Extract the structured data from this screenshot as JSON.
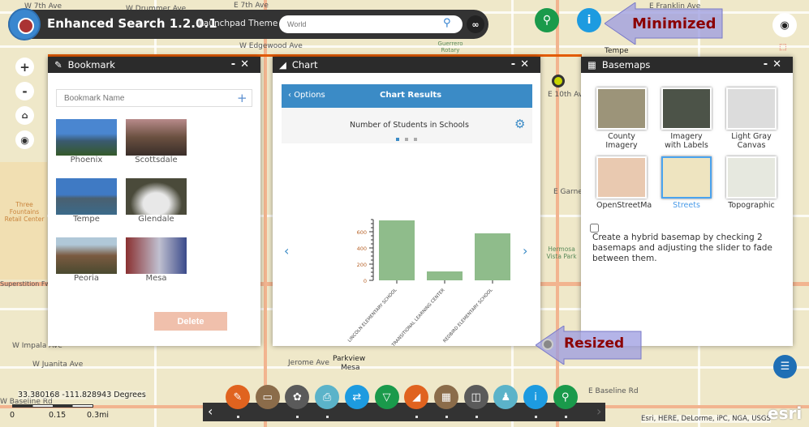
{
  "header": {
    "title": "Enhanced Search 1.2.0.1",
    "theme": "Launchpad Theme",
    "search_placeholder": "World"
  },
  "callouts": {
    "minimized": "Minimized",
    "resized": "Resized"
  },
  "map_labels": [
    "W 7th Ave",
    "W Drummer Ave",
    "W Edgewood Ave",
    "E 7th Ave",
    "E Franklin Ave",
    "Tempe",
    "E 10th Ave",
    "E Garnet",
    "Three Fountains Retail Center",
    "Superstition Fwy",
    "W Impala Ave",
    "W Juanita Ave",
    "Jerome Ave",
    "Parkview",
    "Mesa",
    "E Baseline Rd",
    "W Baseline Rd",
    "Hermosa Vista Park",
    "Guerrero Rotary"
  ],
  "bookmark": {
    "title": "Bookmark",
    "placeholder": "Bookmark Name",
    "items": [
      {
        "name": "Phoenix"
      },
      {
        "name": "Scottsdale"
      },
      {
        "name": "Tempe"
      },
      {
        "name": "Glendale"
      },
      {
        "name": "Peoria"
      },
      {
        "name": "Mesa"
      }
    ],
    "delete_label": "Delete"
  },
  "chart": {
    "title": "Chart",
    "back_label": "Options",
    "header": "Chart Results"
  },
  "chart_data": {
    "type": "bar",
    "title": "Number of Students in Schools",
    "categories": [
      "LINCOLN ELEMENTARY SCHOOL",
      "MESA TRANSITIONAL LEARNING CENTER",
      "REDBIRD ELEMENTARY SCHOOL"
    ],
    "values": [
      740,
      110,
      580
    ],
    "yticks": [
      0,
      200,
      400,
      600
    ],
    "ylim": [
      0,
      750
    ],
    "color": "#8fbc8b",
    "grid": false
  },
  "basemaps": {
    "title": "Basemaps",
    "items": [
      {
        "label": "County Imagery",
        "color": "#9c9479"
      },
      {
        "label": "Imagery with Labels",
        "color": "#4c5348"
      },
      {
        "label": "Light Gray Canvas",
        "color": "#dcdcdc"
      },
      {
        "label": "OpenStreetMa",
        "color": "#e9c9b0"
      },
      {
        "label": "Streets",
        "color": "#eee4c0",
        "selected": true
      },
      {
        "label": "Topographic",
        "color": "#e6e8df"
      }
    ],
    "hybrid_text": "Create a hybrid basemap by checking 2 basemaps and adjusting the slider to fade between them."
  },
  "coords": "33.380168  -111.828943 Degrees",
  "scale": [
    "0",
    "0.15",
    "0.3mi"
  ],
  "attribution": "Esri, HERE, DeLorme, iPC, NGA, USGS",
  "esri_logo": "esri",
  "toolbar": [
    {
      "icon": "bookmark-icon",
      "color": "#e0631f"
    },
    {
      "icon": "measure-icon",
      "color": "#8b6c4a"
    },
    {
      "icon": "layers-icon",
      "color": "#5a5a5a"
    },
    {
      "icon": "print-icon",
      "color": "#5bb3c9"
    },
    {
      "icon": "swipe-icon",
      "color": "#1d9be0"
    },
    {
      "icon": "filter-icon",
      "color": "#1a9a4b"
    },
    {
      "icon": "chart-icon",
      "color": "#e0631f"
    },
    {
      "icon": "basemap-icon",
      "color": "#8b6c4a"
    },
    {
      "icon": "split-icon",
      "color": "#5a5a5a"
    },
    {
      "icon": "street-view-icon",
      "color": "#5bb3c9"
    },
    {
      "icon": "info-icon",
      "color": "#1d9be0"
    },
    {
      "icon": "search-icon",
      "color": "#1a9a4b"
    }
  ],
  "colors": {
    "accent": "#e35b00",
    "chart_header": "#3b8bc6"
  }
}
